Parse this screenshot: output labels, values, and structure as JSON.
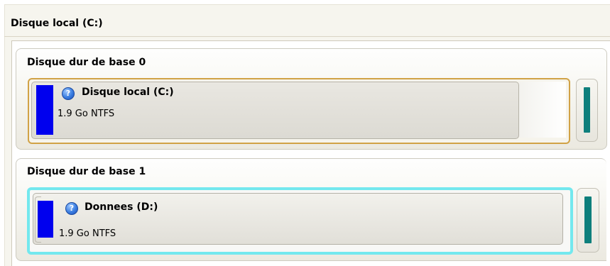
{
  "window": {
    "title": "Disque local (C:)"
  },
  "disks": [
    {
      "title": "Disque dur de base 0",
      "partitions": [
        {
          "name": "Disque local (C:)",
          "info": "1.9 Go NTFS",
          "icon": "help-icon",
          "selected_style": "orange"
        }
      ]
    },
    {
      "title": "Disque dur de base 1",
      "partitions": [
        {
          "name": "Donnees (D:)",
          "info": "1.9 Go NTFS",
          "icon": "help-icon",
          "selected_style": "cyan"
        }
      ]
    }
  ],
  "colors": {
    "partition_fill": "#0000ee",
    "unallocated_indicator": "#0e7f7c",
    "selection_orange": "#d1a246",
    "selection_cyan": "#73e8ee"
  }
}
